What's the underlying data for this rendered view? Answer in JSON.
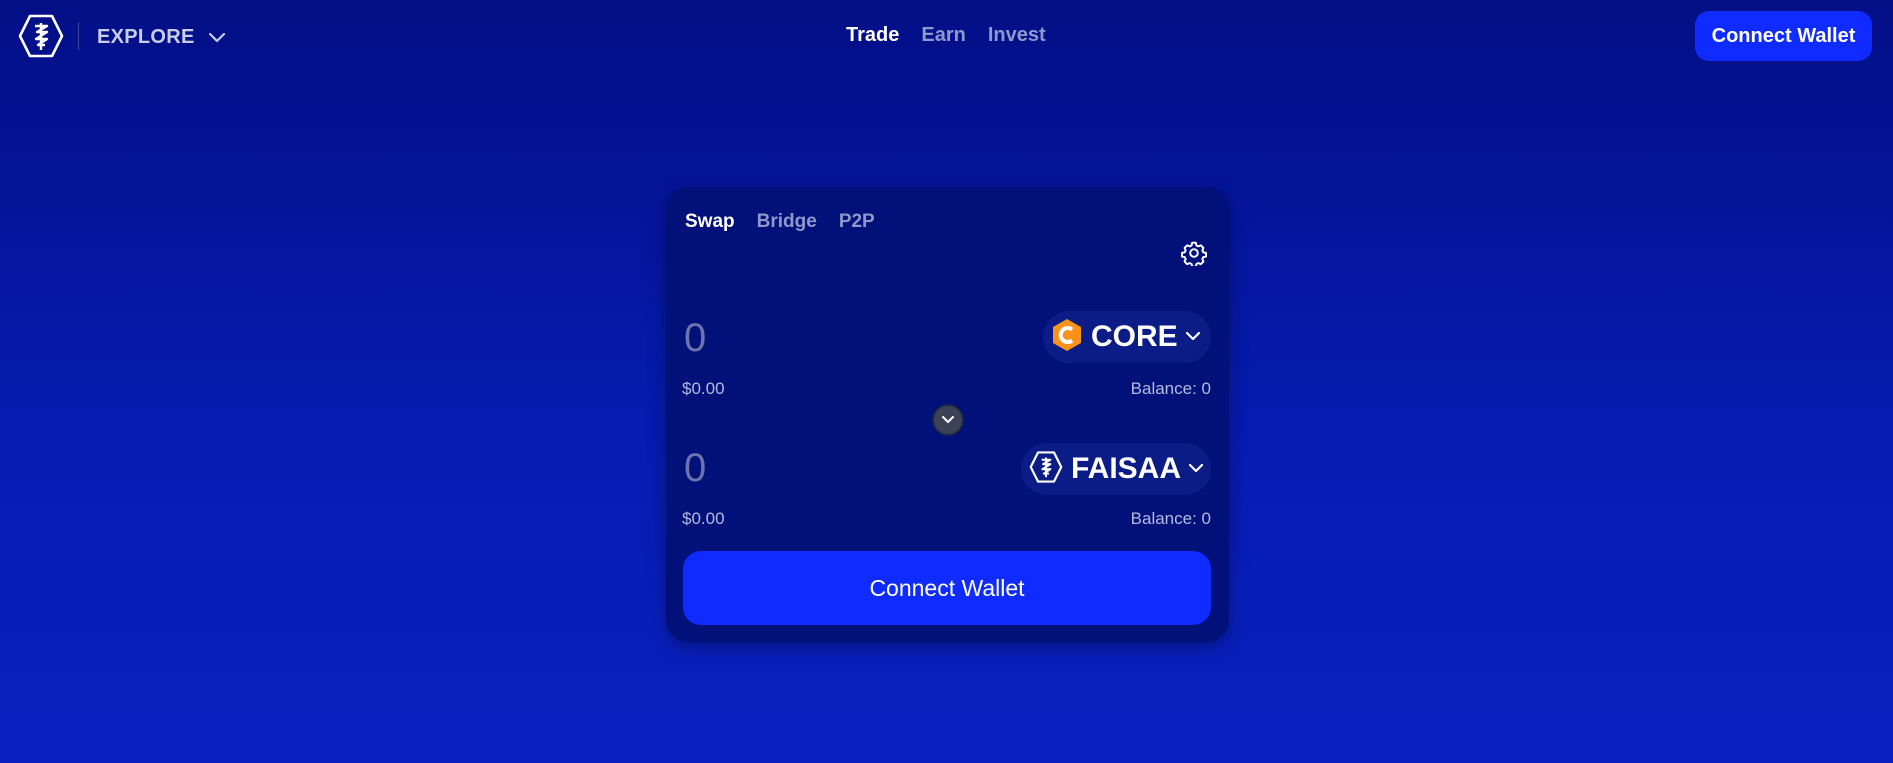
{
  "header": {
    "explore_label": "EXPLORE",
    "nav": [
      {
        "label": "Trade",
        "active": true
      },
      {
        "label": "Earn",
        "active": false
      },
      {
        "label": "Invest",
        "active": false
      }
    ],
    "connect_wallet_label": "Connect Wallet"
  },
  "swap": {
    "tabs": [
      {
        "label": "Swap",
        "active": true
      },
      {
        "label": "Bridge",
        "active": false
      },
      {
        "label": "P2P",
        "active": false
      }
    ],
    "from": {
      "amount_placeholder": "0",
      "usd_value": "$0.00",
      "balance": "Balance: 0",
      "token": {
        "symbol": "CORE",
        "icon": "core-token-icon",
        "icon_color": "#f7931a"
      }
    },
    "to": {
      "amount_placeholder": "0",
      "usd_value": "$0.00",
      "balance": "Balance: 0",
      "token": {
        "symbol": "FAISAA",
        "icon": "faisaa-token-icon"
      }
    },
    "switch_icon": "chevron-down-icon",
    "connect_wallet_label": "Connect Wallet"
  },
  "colors": {
    "background_top": "#030f86",
    "background_bottom": "#0a21c2",
    "card": "#02107a",
    "accent": "#0f2bff",
    "muted_text": "#8f98cc"
  }
}
